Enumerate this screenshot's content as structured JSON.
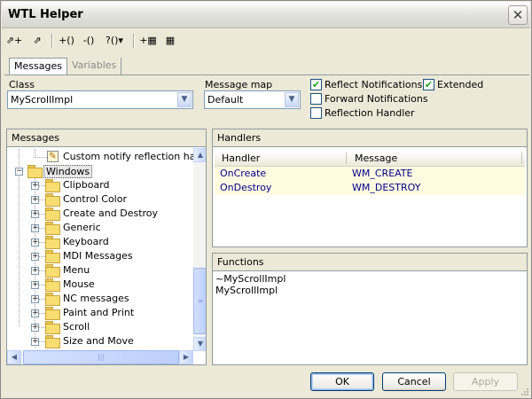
{
  "window": {
    "title": "WTL Helper",
    "close_symbol": "✕"
  },
  "toolbar": {
    "buttons": [
      {
        "name": "add-handler-icon",
        "glyph": "⇗+"
      },
      {
        "name": "add-function-icon",
        "glyph": "⇗"
      },
      {
        "name": "add-message-icon",
        "glyph": "+()"
      },
      {
        "name": "delete-function-icon",
        "glyph": "-()"
      },
      {
        "name": "options-dropdown-icon",
        "glyph": "?()▾"
      },
      {
        "name": "add-variable-icon",
        "glyph": "+▦"
      },
      {
        "name": "variables-icon",
        "glyph": "▦"
      }
    ]
  },
  "tabs": [
    {
      "label": "Messages",
      "active": true
    },
    {
      "label": "Variables",
      "active": false
    }
  ],
  "class_field": {
    "label": "Class",
    "value": "MyScrollImpl"
  },
  "message_map_field": {
    "label": "Message map",
    "value": "Default"
  },
  "checkboxes": {
    "reflect": {
      "label": "Reflect Notifications",
      "checked": true,
      "mark": "✔"
    },
    "forward": {
      "label": "Forward Notifications",
      "checked": false,
      "mark": ""
    },
    "reflection_handler": {
      "label": "Reflection Handler",
      "checked": false,
      "mark": ""
    },
    "extended": {
      "label": "Extended",
      "checked": true,
      "mark": "✔"
    }
  },
  "messages_panel": {
    "title": "Messages",
    "top_item": "Custom notify reflection handler",
    "root": {
      "label": "Windows",
      "expander": "−"
    },
    "items": [
      "Clipboard",
      "Control Color",
      "Create and Destroy",
      "Generic",
      "Keyboard",
      "MDI Messages",
      "Menu",
      "Mouse",
      "NC messages",
      "Paint and Print",
      "Scroll",
      "Size and Move"
    ],
    "item_expander": "+"
  },
  "handlers_panel": {
    "title": "Handlers",
    "columns": [
      "Handler",
      "Message"
    ],
    "rows": [
      {
        "handler": "OnCreate",
        "message": "WM_CREATE"
      },
      {
        "handler": "OnDestroy",
        "message": "WM_DESTROY"
      }
    ]
  },
  "functions_panel": {
    "title": "Functions",
    "items": [
      "~MyScrollImpl",
      "MyScrollImpl"
    ]
  },
  "scroll": {
    "up": "▲",
    "down": "▼",
    "left": "◀",
    "right": "▶",
    "thumb_grip": "≡",
    "hthumb_grip": "|||"
  },
  "buttons": {
    "ok": "OK",
    "cancel": "Cancel",
    "apply": "Apply"
  },
  "colors": {
    "handler_row_bg": "#fffbe0",
    "handler_text": "#00008b",
    "checkbox_mark": "#21a121"
  }
}
